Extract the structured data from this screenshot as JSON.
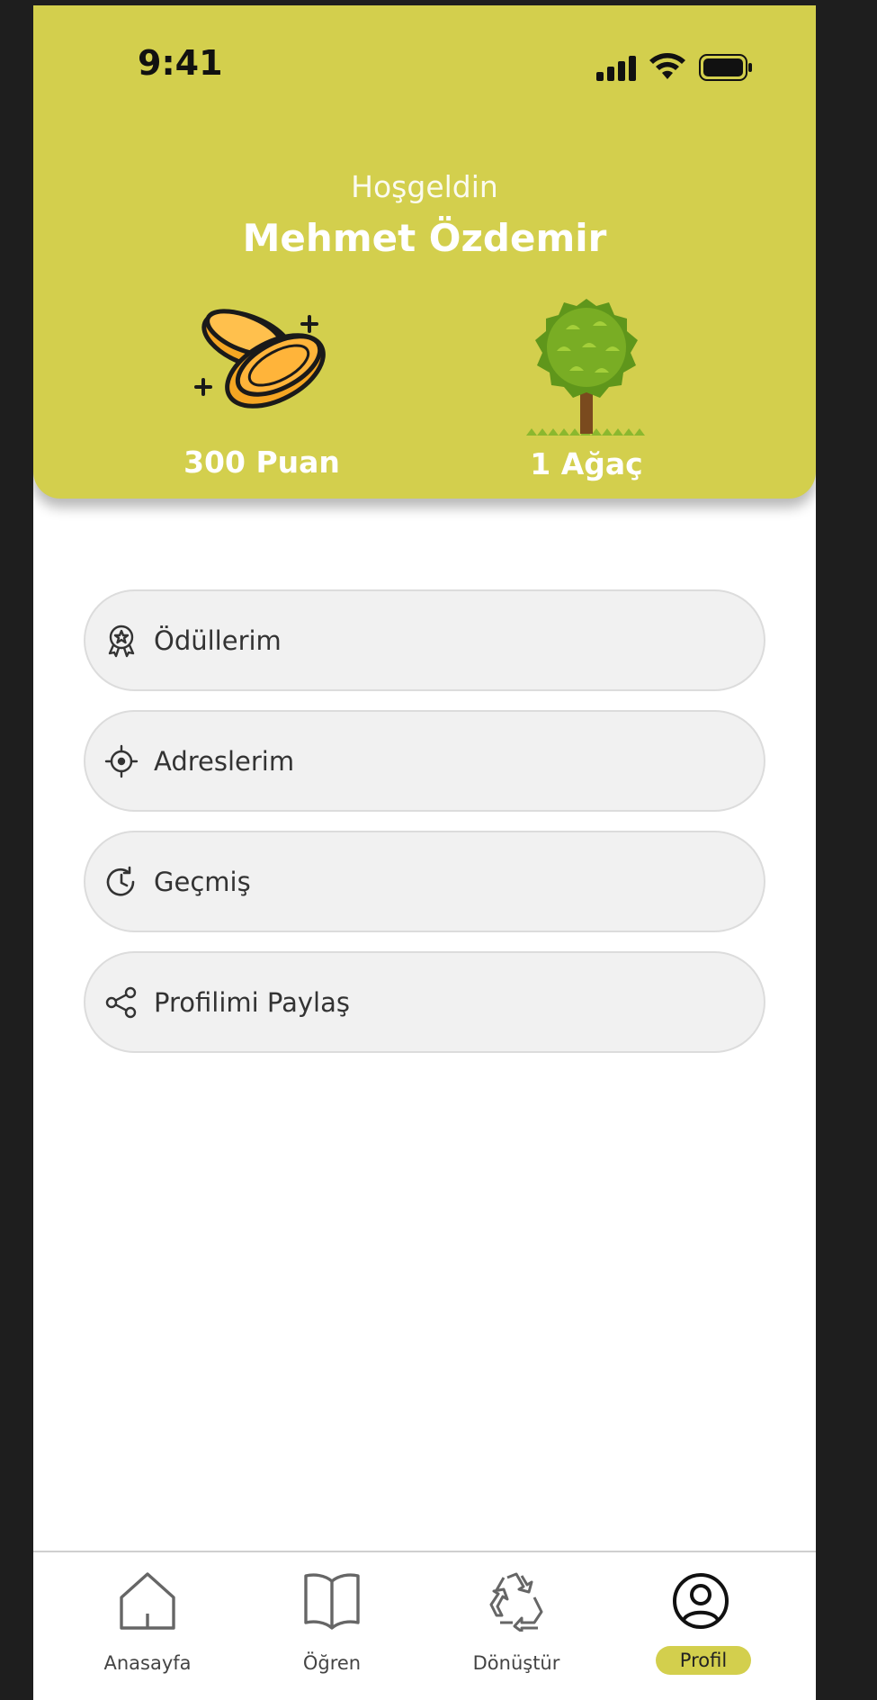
{
  "status": {
    "time": "9:41"
  },
  "header": {
    "greeting": "Hoşgeldin",
    "name": "Mehmet Özdemir",
    "points_label": "300 Puan",
    "trees_label": "1 Ağaç"
  },
  "menu": {
    "items": [
      {
        "label": "Ödüllerim",
        "icon": "award-icon"
      },
      {
        "label": "Adreslerim",
        "icon": "location-crosshair-icon"
      },
      {
        "label": "Geçmiş",
        "icon": "history-icon"
      },
      {
        "label": "Profilimi Paylaş",
        "icon": "share-icon"
      }
    ]
  },
  "tabbar": {
    "tabs": [
      {
        "label": "Anasayfa",
        "icon": "home-icon"
      },
      {
        "label": "Öğren",
        "icon": "book-icon"
      },
      {
        "label": "Dönüştür",
        "icon": "recycle-icon"
      },
      {
        "label": "Profil",
        "icon": "profile-icon",
        "active": true
      }
    ]
  },
  "colors": {
    "accent": "#d3cf4d",
    "text": "#333333",
    "menu_bg": "#f1f1f1"
  }
}
